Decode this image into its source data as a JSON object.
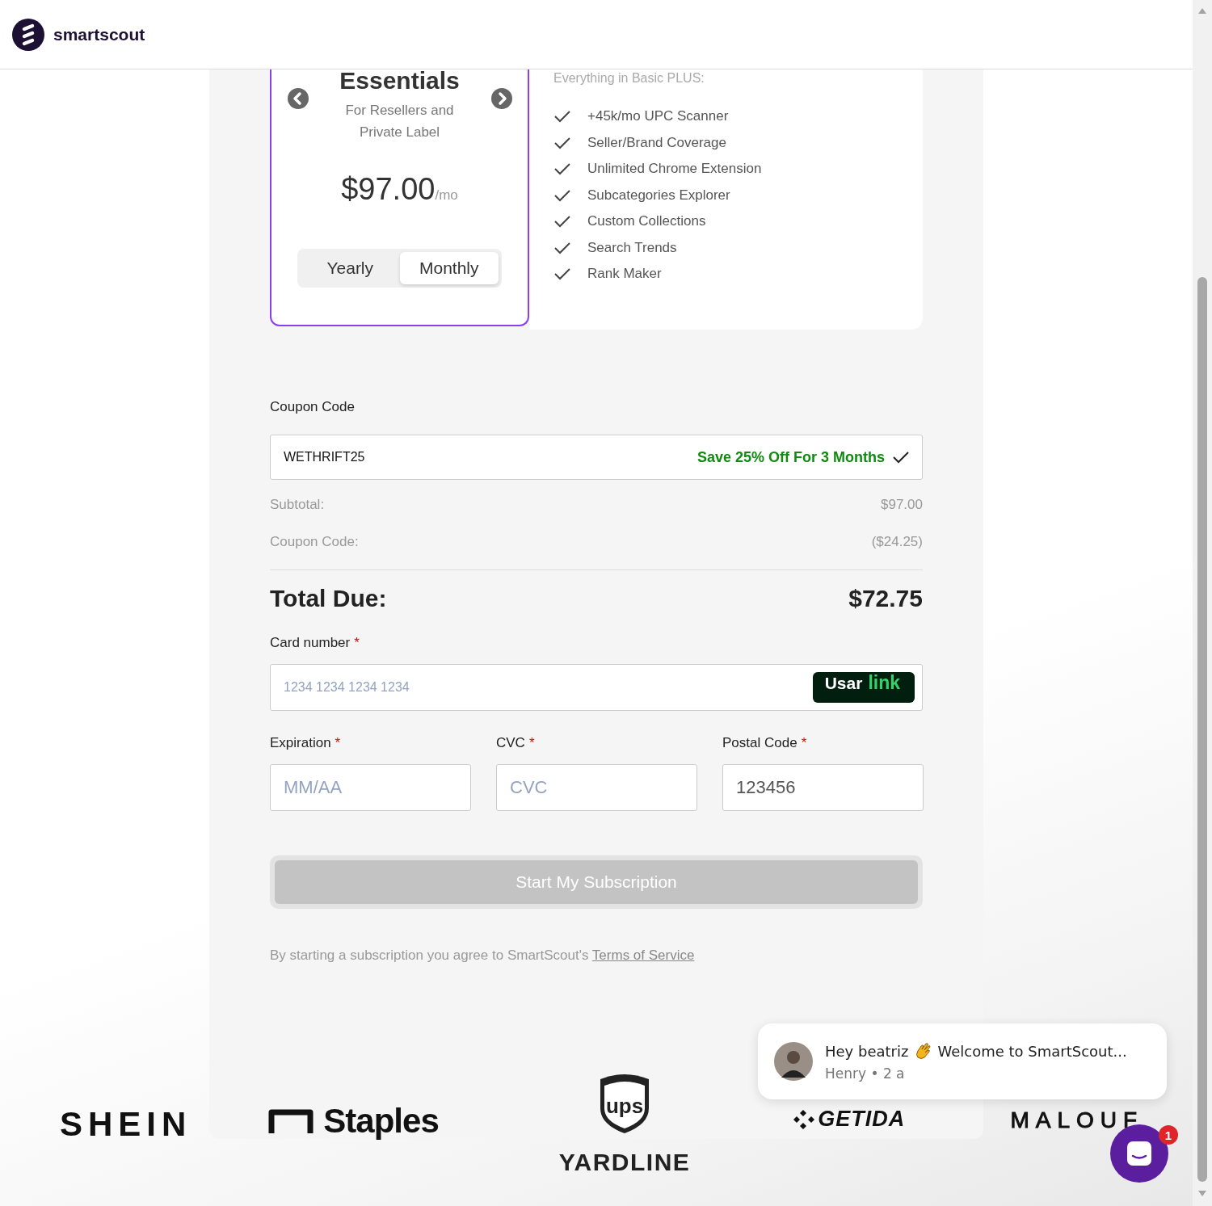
{
  "header": {
    "logo_text": "smartscout"
  },
  "plan_card": {
    "title": "Essentials",
    "subtitle": "For Resellers and Private Label",
    "price": "$97.00",
    "period": "/mo",
    "billing_options": [
      {
        "label": "Yearly",
        "selected": false
      },
      {
        "label": "Monthly",
        "selected": true
      }
    ]
  },
  "features": {
    "heading": "Everything in Basic PLUS:",
    "items": [
      "+45k/mo UPC Scanner",
      "Seller/Brand Coverage",
      "Unlimited Chrome Extension",
      "Subcategories Explorer",
      "Custom Collections",
      "Search Trends",
      "Rank Maker"
    ]
  },
  "coupon": {
    "label": "Coupon Code",
    "value": "WETHRIFT25",
    "message": "Save 25% Off For 3 Months",
    "valid": true
  },
  "summary": [
    {
      "label": "Subtotal:",
      "value": "$97.00"
    },
    {
      "label": "Coupon Code:",
      "value": "($24.25)"
    }
  ],
  "total": {
    "label": "Total Due:",
    "value": "$72.75"
  },
  "card_number": {
    "label": "Card number",
    "marker": "*",
    "placeholder": "1234 1234 1234 1234",
    "link_button": {
      "text": "Usar",
      "brand": "link"
    }
  },
  "fields": [
    {
      "label": "Expiration",
      "marker": "*",
      "placeholder": "MM/AA"
    },
    {
      "label": "CVC",
      "marker": "*",
      "placeholder": "CVC"
    },
    {
      "label": "Postal Code",
      "marker": "*",
      "value": "123456"
    }
  ],
  "submit": {
    "label": "Start My Subscription",
    "disabled": true
  },
  "terms": {
    "text": "By starting a subscription you agree to SmartScout's",
    "link": "Terms of Service"
  },
  "logos": [
    {
      "text": "SHEIN",
      "kind": "shein"
    },
    {
      "text": "Staples",
      "kind": "staples"
    },
    {
      "text": "ups",
      "kind": "ups"
    },
    {
      "text": "GETIDA",
      "kind": "getida"
    },
    {
      "text": "MALOUF",
      "kind": "malouf"
    },
    {
      "text": "YARDLINE",
      "kind": "yardline"
    }
  ],
  "chat": {
    "greeting": "Hey beatriz",
    "message": "Welcome to SmartScout...",
    "meta": "Henry • 2 a",
    "unread": "1"
  }
}
